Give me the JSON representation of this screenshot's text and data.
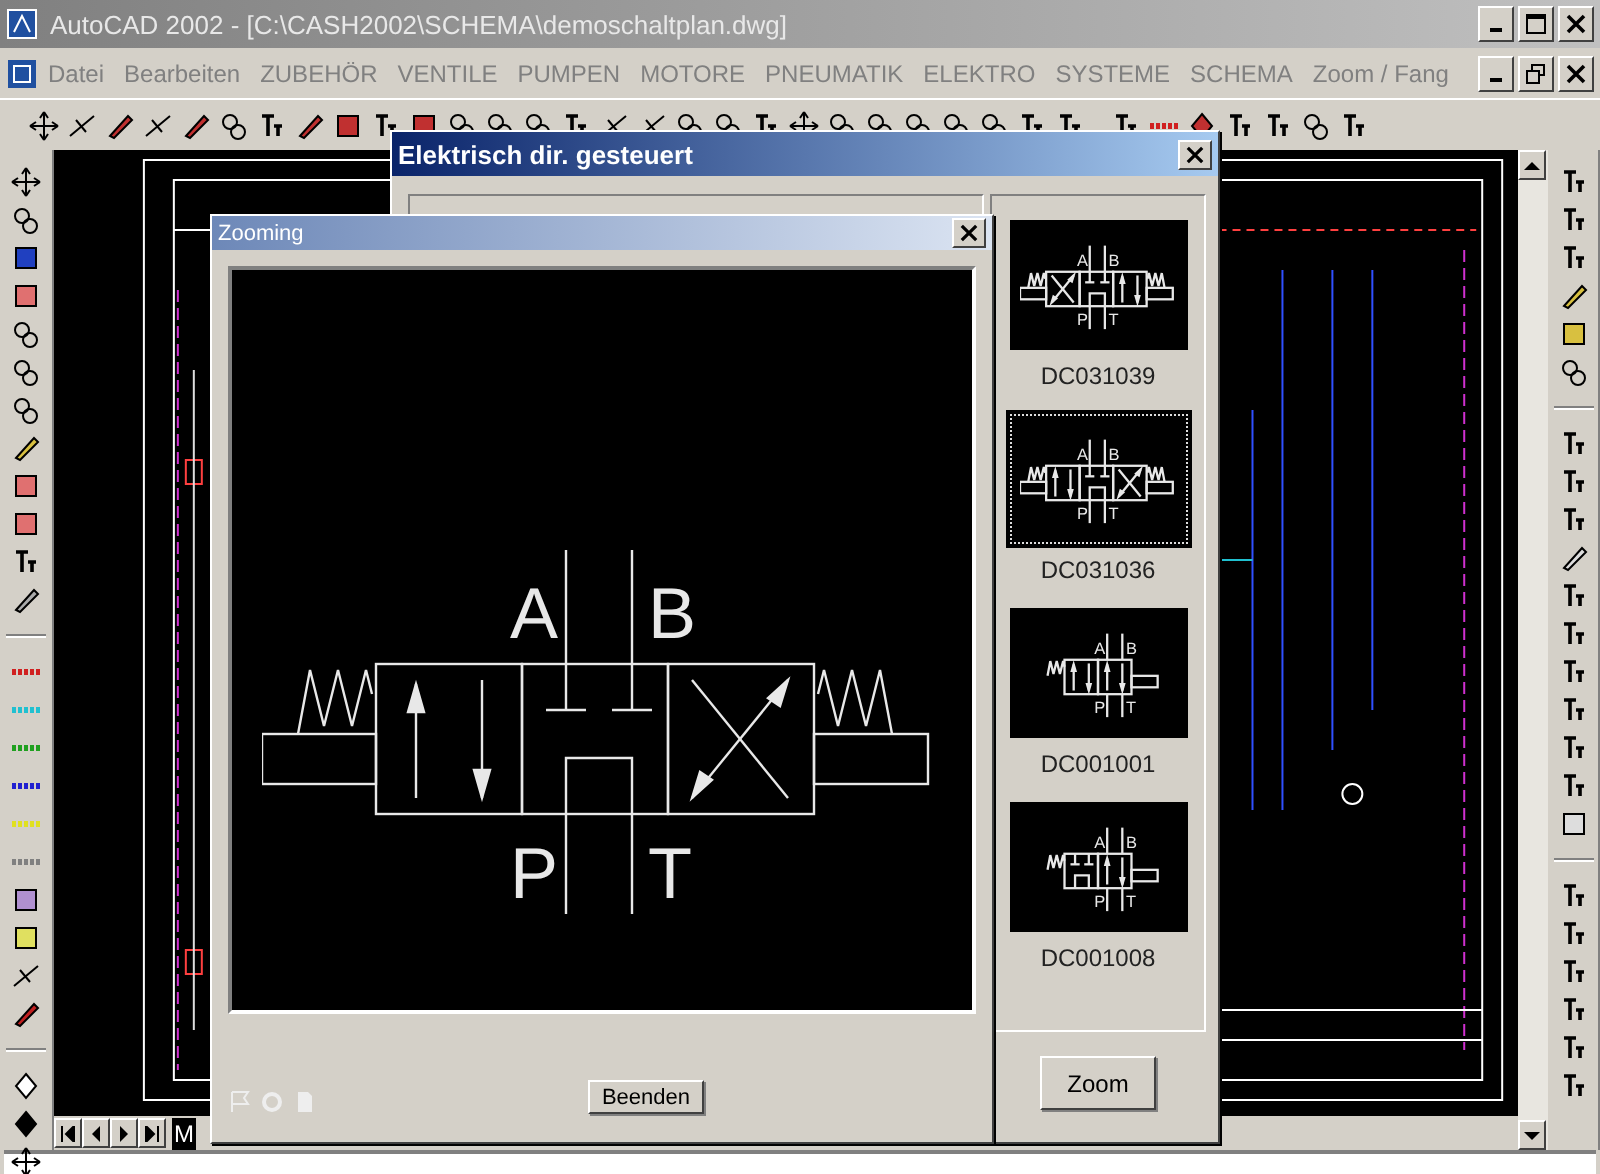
{
  "window": {
    "title": "AutoCAD 2002 - [C:\\CASH2002\\SCHEMA\\demoschaltplan.dwg]"
  },
  "menu": [
    "Datei",
    "Bearbeiten",
    "ZUBEHÖR",
    "VENTILE",
    "PUMPEN",
    "MOTORE",
    "PNEUMATIK",
    "ELEKTRO",
    "SYSTEME",
    "SCHEMA",
    "Zoom / Fang"
  ],
  "layout_tab": "M",
  "dialog": {
    "title": "Elektrisch dir. gesteuert",
    "zoom_button": "Zoom",
    "thumbnails": [
      {
        "label": "DC031039",
        "kind": "cross-left",
        "selected": false,
        "ports": [
          "A",
          "B",
          "P",
          "T"
        ]
      },
      {
        "label": "DC031036",
        "kind": "cross-right",
        "selected": true,
        "ports": [
          "A",
          "B",
          "P",
          "T"
        ]
      },
      {
        "label": "DC001001",
        "kind": "single",
        "selected": false,
        "ports": [
          "A",
          "B",
          "P",
          "T"
        ]
      },
      {
        "label": "DC001008",
        "kind": "single-blocked",
        "selected": false,
        "ports": [
          "A",
          "B",
          "P",
          "T"
        ]
      }
    ]
  },
  "zoom_dialog": {
    "title": "Zooming",
    "kind": "cross-right",
    "ports": [
      "A",
      "B",
      "P",
      "T"
    ],
    "button": "Beenden"
  }
}
